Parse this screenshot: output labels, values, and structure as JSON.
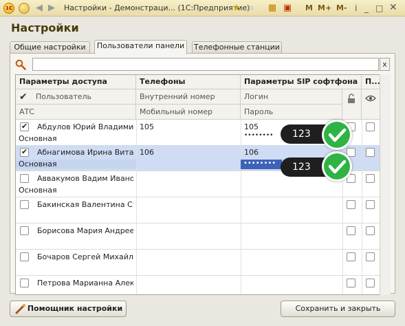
{
  "window": {
    "title": "Настройки - Демонстраци... (1С:Предприятие)",
    "mem_buttons": [
      "M",
      "M+",
      "M-"
    ]
  },
  "heading": "Настройки",
  "tabs": [
    {
      "label": "Общие настройки"
    },
    {
      "label": "Пользователи панели"
    },
    {
      "label": "Телефонные станции"
    }
  ],
  "active_tab": "Пользователи панели",
  "search": {
    "value": "",
    "clear": "x"
  },
  "grid": {
    "header": {
      "col1": "Параметры доступа",
      "col2": "Телефоны",
      "col3": "Параметры SIP софтфона",
      "col4": "П...",
      "sub1a": "Пользователь",
      "sub1b": "АТС",
      "sub2a": "Внутренний номер",
      "sub2b": "Мобильный номер",
      "sub3a": "Логин",
      "sub3b": "Пароль"
    },
    "rows": [
      {
        "checked": true,
        "name": "Абдулов Юрий Владимир...",
        "atc": "Основная",
        "ext": "105",
        "login": "105",
        "password": "••••••••",
        "lock": true,
        "eye": true,
        "selected": false
      },
      {
        "checked": true,
        "name": "Абнагимова Ирина Витал...",
        "atc": "Основная",
        "ext": "106",
        "login": "106",
        "password": "••••••••",
        "lock": true,
        "eye": true,
        "selected": true
      },
      {
        "checked": false,
        "name": "Аввакумов Вадим Ивано...",
        "atc": "Основная",
        "ext": "",
        "login": "",
        "password": "",
        "lock": true,
        "eye": true,
        "selected": false
      },
      {
        "checked": false,
        "name": "Бакинская Валентина Ст...",
        "atc": "",
        "ext": "",
        "login": "",
        "password": "",
        "lock": true,
        "eye": true,
        "selected": false
      },
      {
        "checked": false,
        "name": "Борисова Мария Андрее...",
        "atc": "",
        "ext": "",
        "login": "",
        "password": "",
        "lock": true,
        "eye": true,
        "selected": false
      },
      {
        "checked": false,
        "name": "Бочаров Сергей Михайло...",
        "atc": "",
        "ext": "",
        "login": "",
        "password": "",
        "lock": true,
        "eye": true,
        "selected": false
      },
      {
        "checked": false,
        "name": "Петрова Марианна Алек...",
        "atc": "",
        "ext": "",
        "login": "",
        "password": "",
        "lock": true,
        "eye": true,
        "selected": false
      }
    ]
  },
  "callouts": [
    {
      "text": "123"
    },
    {
      "text": "123"
    }
  ],
  "buttons": {
    "help": "Помощник настройки",
    "save": "Сохранить и закрыть"
  },
  "colors": {
    "selected_row": "#cfdcf3",
    "ok_green": "#2fb344",
    "heading": "#4a3b0d"
  }
}
